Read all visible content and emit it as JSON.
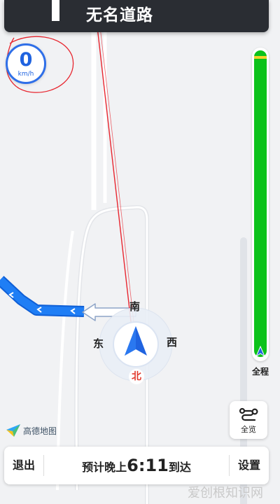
{
  "navigation": {
    "road_name": "无名道路",
    "speed": {
      "value": "0",
      "unit": "km/h"
    },
    "progress": {
      "label": "全程",
      "remaining_fraction": 0.97
    },
    "overview": {
      "label": "全览",
      "icon": "route-overview-icon"
    },
    "logo_text": "高德地图",
    "compass": {
      "south": "南",
      "east": "东",
      "west": "西",
      "north": "北"
    },
    "bottom": {
      "exit": "退出",
      "eta_prefix": "预计晚上",
      "eta_time": "6:11",
      "eta_suffix": "到达",
      "settings": "设置"
    },
    "watermark": "爱创根知识网"
  },
  "colors": {
    "route_blue": "#1f7ef5",
    "progress_green": "#0cc21a",
    "banner_dark": "#2a2d33",
    "annotation_red": "#e8262f"
  }
}
